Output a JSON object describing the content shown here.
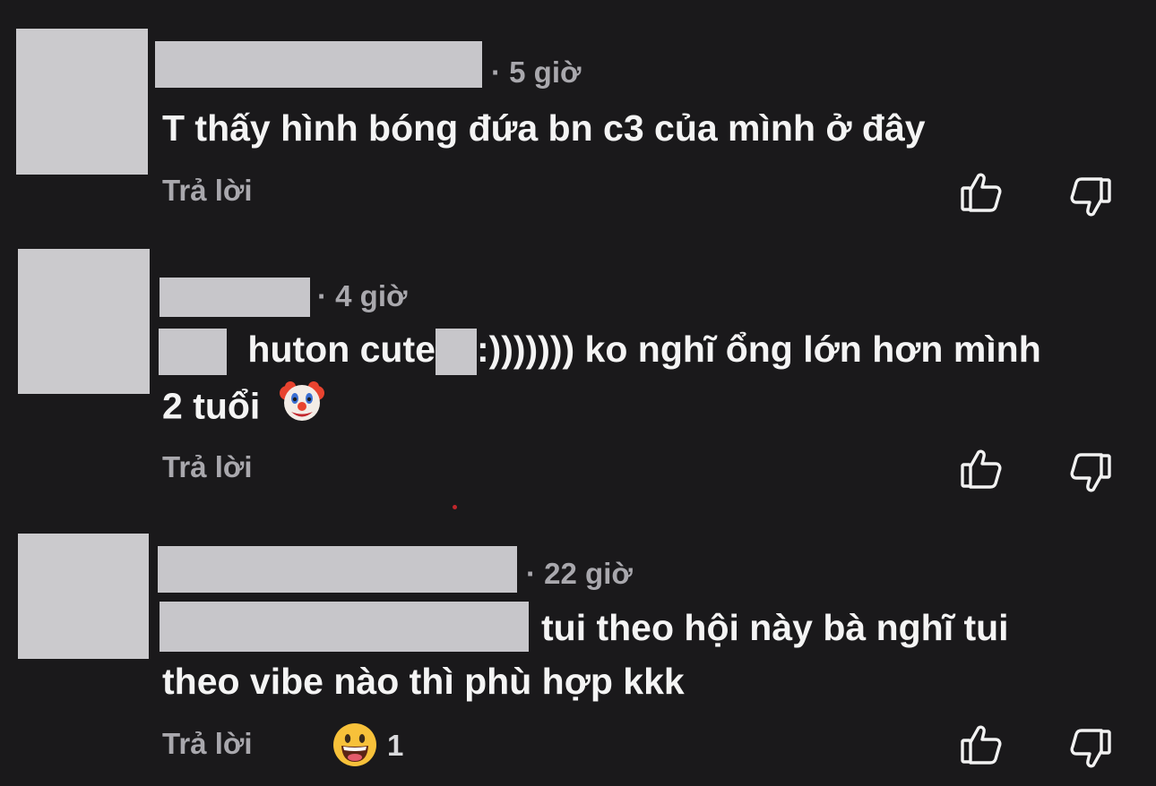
{
  "comments": [
    {
      "time": "· 5 giờ",
      "line1": "T thấy hình bóng đứa bn c3 của mình ở đây",
      "reply_label": "Trả lời",
      "like_icon": "thumbs-up-icon",
      "dislike_icon": "thumbs-down-icon"
    },
    {
      "time": "· 4 giờ",
      "line1_part1": "huton cute",
      "line1_part2": ":))))))) ko nghĩ ổng lớn hơn mình",
      "line2": "2 tuổi",
      "emoji_icon": "clown-face-icon",
      "reply_label": "Trả lời",
      "like_icon": "thumbs-up-icon",
      "dislike_icon": "thumbs-down-icon"
    },
    {
      "time": "· 22 giờ",
      "line1": "tui theo hội này bà nghĩ tui",
      "line2": "theo vibe nào thì phù hợp kkk",
      "reply_label": "Trả lời",
      "reaction_emoji": "grinning-face-sweat-icon",
      "reaction_count": "1",
      "like_icon": "thumbs-up-icon",
      "dislike_icon": "thumbs-down-icon"
    }
  ],
  "colors": {
    "background": "#1a191b",
    "text": "#f4f4f4",
    "muted": "#a9a8ad",
    "redaction": "#c7c6ca"
  }
}
